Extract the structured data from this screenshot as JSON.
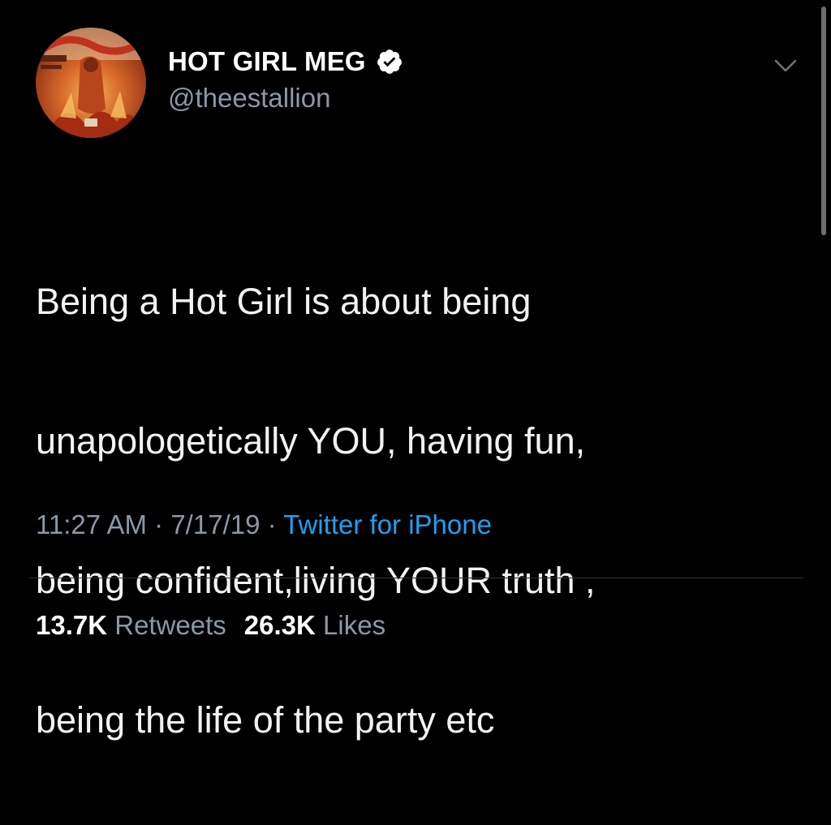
{
  "tweet": {
    "display_name": "HOT GIRL MEG",
    "handle": "@theestallion",
    "verified": true,
    "avatar_icon": "album-cover-avatar",
    "text_lines": [
      "Being a Hot Girl is about being",
      "unapologetically YOU, having fun,",
      "being confident,living YOUR truth ,",
      "being the life of the party etc"
    ],
    "time": "11:27 AM",
    "date": "7/17/19",
    "separator": "·",
    "source": "Twitter for iPhone",
    "retweets_count": "13.7K",
    "retweets_label": "Retweets",
    "likes_count": "26.3K",
    "likes_label": "Likes"
  },
  "colors": {
    "background": "#000000",
    "text": "#ffffff",
    "secondary_text": "#8b98a5",
    "link": "#1da1f2",
    "verified_badge": "#ffffff"
  }
}
